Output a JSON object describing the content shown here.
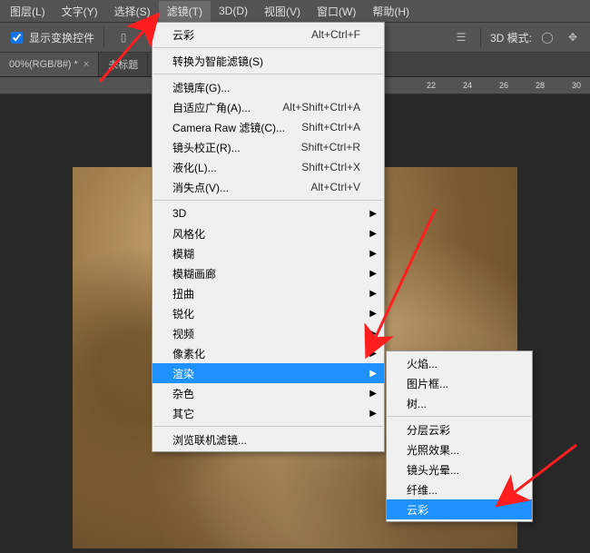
{
  "menubar": {
    "items": [
      "图层(L)",
      "文字(Y)",
      "选择(S)",
      "滤镜(T)",
      "3D(D)",
      "视图(V)",
      "窗口(W)",
      "帮助(H)"
    ]
  },
  "toolbar": {
    "transform_label": "显示变换控件",
    "mode_label": "3D 模式:"
  },
  "tabs": [
    {
      "label": "00%(RGB/8#) *"
    },
    {
      "label": "未标题"
    }
  ],
  "ruler_ticks": [
    "22",
    "24",
    "26",
    "28",
    "30"
  ],
  "filter_menu": {
    "repeat": {
      "label": "云彩",
      "shortcut": "Alt+Ctrl+F"
    },
    "convert": {
      "label": "转换为智能滤镜(S)"
    },
    "gallery": {
      "label": "滤镜库(G)..."
    },
    "adaptive": {
      "label": "自适应广角(A)...",
      "shortcut": "Alt+Shift+Ctrl+A"
    },
    "camera": {
      "label": "Camera Raw 滤镜(C)...",
      "shortcut": "Shift+Ctrl+A"
    },
    "lens": {
      "label": "镜头校正(R)...",
      "shortcut": "Shift+Ctrl+R"
    },
    "liquify": {
      "label": "液化(L)...",
      "shortcut": "Shift+Ctrl+X"
    },
    "vanish": {
      "label": "消失点(V)...",
      "shortcut": "Alt+Ctrl+V"
    },
    "g3d": {
      "label": "3D"
    },
    "stylize": {
      "label": "风格化"
    },
    "blur": {
      "label": "模糊"
    },
    "blur_gallery": {
      "label": "模糊画廊"
    },
    "distort": {
      "label": "扭曲"
    },
    "sharpen": {
      "label": "锐化"
    },
    "video": {
      "label": "视频"
    },
    "pixelate": {
      "label": "像素化"
    },
    "render": {
      "label": "渲染"
    },
    "noise": {
      "label": "杂色"
    },
    "other": {
      "label": "其它"
    },
    "browse": {
      "label": "浏览联机滤镜..."
    }
  },
  "render_submenu": {
    "flame": {
      "label": "火焰..."
    },
    "picture_frame": {
      "label": "图片框..."
    },
    "tree": {
      "label": "树..."
    },
    "difference_clouds": {
      "label": "分层云彩"
    },
    "lighting": {
      "label": "光照效果..."
    },
    "lens_flare": {
      "label": "镜头光晕..."
    },
    "fibers": {
      "label": "纤维..."
    },
    "clouds": {
      "label": "云彩"
    }
  }
}
